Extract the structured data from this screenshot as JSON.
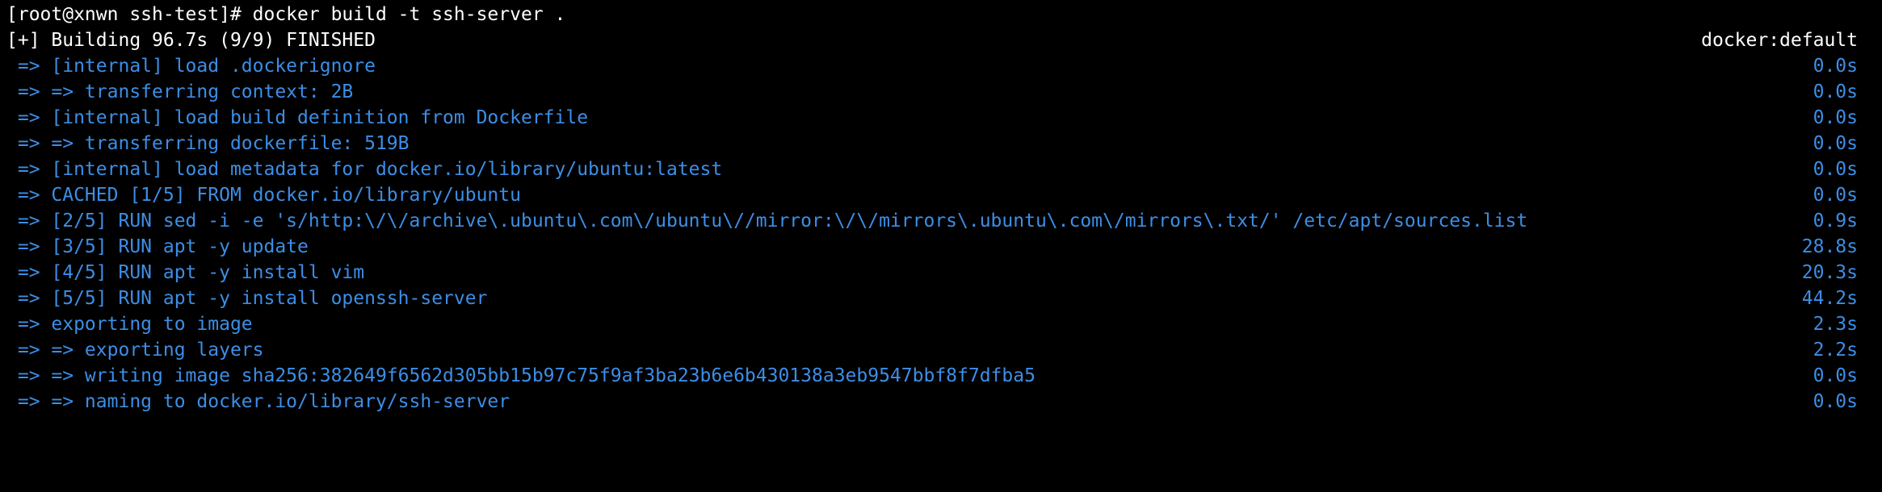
{
  "colors": {
    "background": "#000000",
    "text_white": "#ffffff",
    "text_blue": "#3c8ee6"
  },
  "command_line": "[root@xnwn ssh-test]# docker build -t ssh-server .",
  "status": {
    "left": "[+] Building 96.7s (9/9) FINISHED",
    "right": "docker:default"
  },
  "steps": [
    {
      "text": " => [internal] load .dockerignore",
      "time": "0.0s"
    },
    {
      "text": " => => transferring context: 2B",
      "time": "0.0s"
    },
    {
      "text": " => [internal] load build definition from Dockerfile",
      "time": "0.0s"
    },
    {
      "text": " => => transferring dockerfile: 519B",
      "time": "0.0s"
    },
    {
      "text": " => [internal] load metadata for docker.io/library/ubuntu:latest",
      "time": "0.0s"
    },
    {
      "text": " => CACHED [1/5] FROM docker.io/library/ubuntu",
      "time": "0.0s"
    },
    {
      "text": " => [2/5] RUN sed -i -e 's/http:\\/\\/archive\\.ubuntu\\.com\\/ubuntu\\//mirror:\\/\\/mirrors\\.ubuntu\\.com\\/mirrors\\.txt/' /etc/apt/sources.list",
      "time": "0.9s"
    },
    {
      "text": " => [3/5] RUN apt -y update",
      "time": "28.8s"
    },
    {
      "text": " => [4/5] RUN apt -y install vim",
      "time": "20.3s"
    },
    {
      "text": " => [5/5] RUN apt -y install openssh-server",
      "time": "44.2s"
    },
    {
      "text": " => exporting to image",
      "time": "2.3s"
    },
    {
      "text": " => => exporting layers",
      "time": "2.2s"
    },
    {
      "text": " => => writing image sha256:382649f6562d305bb15b97c75f9af3ba23b6e6b430138a3eb9547bbf8f7dfba5",
      "time": "0.0s"
    },
    {
      "text": " => => naming to docker.io/library/ssh-server",
      "time": "0.0s"
    }
  ]
}
